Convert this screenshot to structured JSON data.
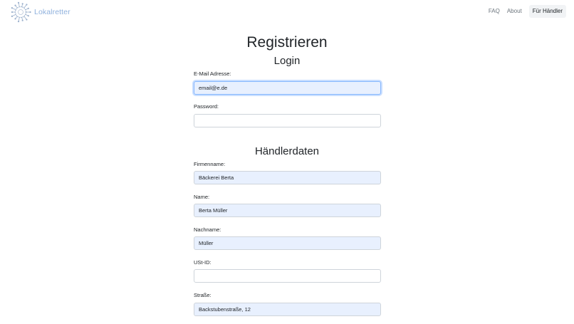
{
  "navbar": {
    "brand": "Lokalretter",
    "links": [
      "FAQ",
      "About"
    ],
    "cta": "Für Händler"
  },
  "page": {
    "title": "Registrieren"
  },
  "login": {
    "heading": "Login",
    "email_label": "E-Mail Adresse:",
    "email_value": "email@e.de",
    "password_label": "Password:",
    "password_value": ""
  },
  "haendler": {
    "heading": "Händlerdaten",
    "firma_label": "Firmenname:",
    "firma_value": "Bäckerei Berta",
    "name_label": "Name:",
    "name_value": "Berta Müller",
    "nachname_label": "Nachname:",
    "nachname_value": "Müller",
    "ustid_label": "USt-ID:",
    "ustid_value": "",
    "strasse_label": "Straße:",
    "strasse_value": "Backstubenstraße, 12"
  },
  "colors": {
    "brand_text": "#8fb1dd",
    "autofill_bg": "#e8f0fe",
    "focus_border": "#86b7fe"
  }
}
